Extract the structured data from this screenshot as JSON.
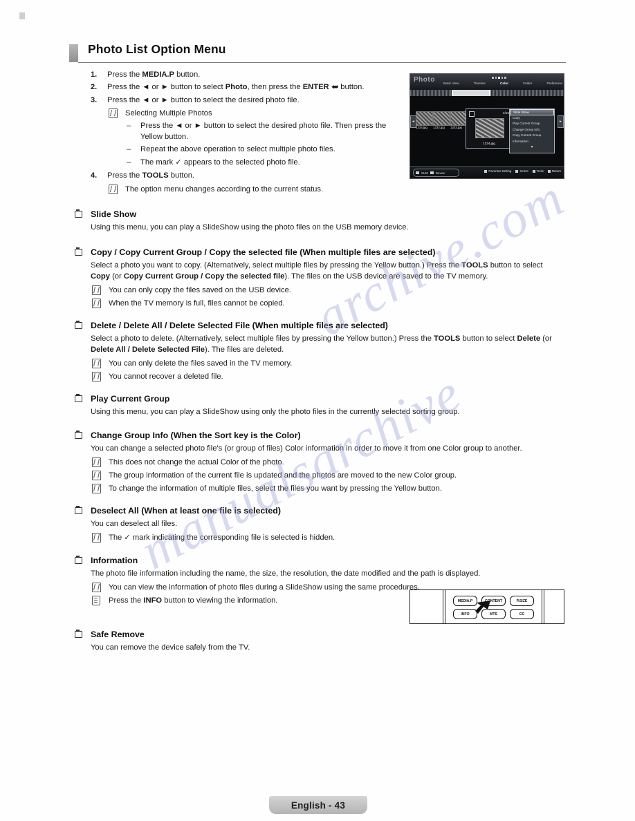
{
  "header": {
    "title": "Photo List Option Menu"
  },
  "steps": [
    {
      "num": "1.",
      "parts": [
        {
          "t": "Press the ",
          "b": false
        },
        {
          "t": "MEDIA.P",
          "b": true
        },
        {
          "t": " button.",
          "b": false
        }
      ]
    },
    {
      "num": "2.",
      "parts": [
        {
          "t": "Press the ◄ or ► button to select ",
          "b": false
        },
        {
          "t": "Photo",
          "b": true
        },
        {
          "t": ", then press the ",
          "b": false
        },
        {
          "t": "ENTER",
          "b": true
        },
        {
          "t": " ⮨ button.",
          "b": false
        }
      ]
    },
    {
      "num": "3.",
      "parts": [
        {
          "t": "Press the ◄ or ► button to select the desired photo file.",
          "b": false
        }
      ]
    }
  ],
  "step3_note": "Selecting Multiple Photos",
  "step3_dashes": [
    "Press the ◄ or ► button to select the desired photo file. Then press the Yellow button.",
    "Repeat the above operation to select multiple photo files.",
    "The mark ✓ appears to the selected photo file."
  ],
  "step4": {
    "num": "4.",
    "parts": [
      {
        "t": "Press the ",
        "b": false
      },
      {
        "t": "TOOLS",
        "b": true
      },
      {
        "t": " button.",
        "b": false
      }
    ]
  },
  "step4_note": "The option menu changes according to the current status.",
  "sections": [
    {
      "heading": "Slide Show",
      "body": [
        {
          "type": "p",
          "parts": [
            {
              "t": "Using this menu, you can play a SlideShow using the photo files on the USB memory device.",
              "b": false
            }
          ]
        }
      ]
    },
    {
      "heading": "Copy / Copy Current Group / Copy the selected file (When multiple files are selected)",
      "body": [
        {
          "type": "p",
          "parts": [
            {
              "t": "Select a photo you want to copy. (Alternatively, select multiple files by pressing the Yellow button.) Press the ",
              "b": false
            },
            {
              "t": "TOOLS",
              "b": true
            },
            {
              "t": " button to select ",
              "b": false
            },
            {
              "t": "Copy",
              "b": true
            },
            {
              "t": " (or ",
              "b": false
            },
            {
              "t": "Copy Current Group / Copy the selected file",
              "b": true
            },
            {
              "t": "). The files on the USB device are saved to the TV memory.",
              "b": false
            }
          ]
        },
        {
          "type": "note",
          "parts": [
            {
              "t": "You can only copy the files saved on the USB device.",
              "b": false
            }
          ]
        },
        {
          "type": "note",
          "parts": [
            {
              "t": "When the TV memory is full, files cannot be copied.",
              "b": false
            }
          ]
        }
      ]
    },
    {
      "heading": "Delete / Delete All / Delete Selected File (When multiple files are selected)",
      "body": [
        {
          "type": "p",
          "parts": [
            {
              "t": "Select a photo to delete. (Alternatively, select multiple files by pressing the Yellow button.) Press the ",
              "b": false
            },
            {
              "t": "TOOLS",
              "b": true
            },
            {
              "t": " button to select ",
              "b": false
            },
            {
              "t": "Delete",
              "b": true
            },
            {
              "t": " (or ",
              "b": false
            },
            {
              "t": "Delete All / Delete Selected File",
              "b": true
            },
            {
              "t": "). The files are deleted.",
              "b": false
            }
          ]
        },
        {
          "type": "note",
          "parts": [
            {
              "t": "You can only delete the files saved in the TV memory.",
              "b": false
            }
          ]
        },
        {
          "type": "note",
          "parts": [
            {
              "t": "You cannot recover a deleted file.",
              "b": false
            }
          ]
        }
      ]
    },
    {
      "heading": "Play Current Group",
      "body": [
        {
          "type": "p",
          "parts": [
            {
              "t": "Using this menu, you can play a SlideShow using only the photo files in the currently selected sorting group.",
              "b": false
            }
          ]
        }
      ]
    },
    {
      "heading": "Change Group Info (When the Sort key is the Color)",
      "body": [
        {
          "type": "p",
          "parts": [
            {
              "t": "You can change a selected photo file's (or group of files) Color information in order to move it from one Color group to another.",
              "b": false
            }
          ]
        },
        {
          "type": "note",
          "parts": [
            {
              "t": "This does not change the actual Color of the photo.",
              "b": false
            }
          ]
        },
        {
          "type": "note",
          "parts": [
            {
              "t": "The group information of the current file is updated and the photos are moved to the new Color group.",
              "b": false
            }
          ]
        },
        {
          "type": "note",
          "parts": [
            {
              "t": "To change the information of multiple files, select the files you want by pressing the Yellow button.",
              "b": false
            }
          ]
        }
      ]
    },
    {
      "heading": "Deselect All (When at least one file is selected)",
      "body": [
        {
          "type": "p",
          "parts": [
            {
              "t": "You can deselect all files.",
              "b": false
            }
          ]
        },
        {
          "type": "note",
          "parts": [
            {
              "t": "The ✓ mark indicating the corresponding file is selected is hidden.",
              "b": false
            }
          ]
        }
      ]
    },
    {
      "heading": "Information",
      "body": [
        {
          "type": "p",
          "parts": [
            {
              "t": "The photo file information including the name, the size, the resolution, the date modified and the path is displayed.",
              "b": false
            }
          ]
        },
        {
          "type": "note",
          "parts": [
            {
              "t": "You can view the information of photo files during a SlideShow using the same procedures.",
              "b": false
            }
          ]
        },
        {
          "type": "remote",
          "parts": [
            {
              "t": "Press the ",
              "b": false
            },
            {
              "t": "INFO",
              "b": true
            },
            {
              "t": " button to viewing the information.",
              "b": false
            }
          ]
        }
      ]
    },
    {
      "heading": "Safe Remove",
      "body": [
        {
          "type": "p",
          "parts": [
            {
              "t": "You can remove the device safely from the TV.",
              "b": false
            }
          ]
        }
      ]
    }
  ],
  "tv_screen": {
    "logo": "Photo",
    "tabs": [
      {
        "label": "Basic View",
        "active": false
      },
      {
        "label": "Timeline",
        "active": false
      },
      {
        "label": "Color",
        "active": true
      },
      {
        "label": "Folder",
        "active": false
      },
      {
        "label": "Preference",
        "active": false
      }
    ],
    "thumbnails": [
      {
        "label": "1234.jpg"
      },
      {
        "label": "1232.jpg"
      },
      {
        "label": "1233.jpg"
      }
    ],
    "focus": {
      "count": "2/15",
      "filename": "1234.jpg"
    },
    "menu_items": [
      {
        "label": "Slide Show",
        "selected": true
      },
      {
        "label": "Copy",
        "selected": false
      },
      {
        "label": "Play Current Group",
        "selected": false
      },
      {
        "label": "Change Group Info",
        "selected": false
      },
      {
        "label": "Copy Current Group",
        "selected": false
      },
      {
        "label": "Information",
        "selected": false
      }
    ],
    "device_bar": {
      "sum": "SUM",
      "device": "Device"
    },
    "hints": [
      {
        "label": "Favorites Setting"
      },
      {
        "label": "Select"
      },
      {
        "label": "Tools"
      },
      {
        "label": "Return"
      }
    ],
    "arrow_left": "◄",
    "arrow_right": "►"
  },
  "remote": {
    "buttons": [
      {
        "label": "MEDIA.P"
      },
      {
        "label": "CONTENT"
      },
      {
        "label": "P.SIZE"
      },
      {
        "label": "INFO"
      },
      {
        "label": "MTS"
      },
      {
        "label": "CC"
      }
    ]
  },
  "watermark": {
    "line1": "archive.com",
    "line2": "manualsarchive"
  },
  "footer": {
    "label": "English - 43"
  }
}
